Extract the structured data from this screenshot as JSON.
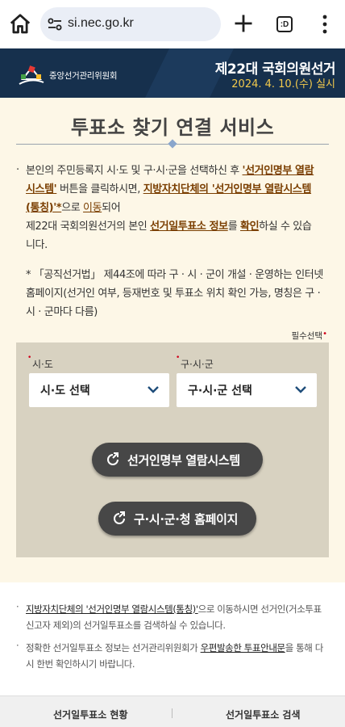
{
  "browser": {
    "url": "si.nec.go.kr",
    "tab_count": ":D"
  },
  "header": {
    "org_name": "중앙선거관리위원회",
    "election_title": "제22대 국회의원선거",
    "election_date": "2024. 4. 10.(수) 실시"
  },
  "main": {
    "title": "투표소 찾기 연결 서비스",
    "intro": {
      "p1": "본인의 주민등록지 시·도 및 구·시·군을 선택하신 후 ",
      "link1": "'선거인명부 열람시스템'",
      "p2": " 버튼을 클릭하시면, ",
      "link2": "지방자치단체의 '선거인명부 열람시스템(통칭)'*",
      "p3": "으로 ",
      "link3": "이동",
      "p4": "되어",
      "p5": "제22대 국회의원선거의 본인 ",
      "link4": "선거일투표소 정보",
      "p6": "를 ",
      "link5": "확인",
      "p7": "하실 수 있습니다."
    },
    "note": "* 「공직선거법」 제44조에 따라 구 · 시 · 군이 개설 · 운영하는 인터넷 홈페이지(선거인 여부, 등재번호 및 투표소 위치 확인 가능, 명칭은 구 · 시 · 군마다 다름)",
    "required_note": "필수선택"
  },
  "form": {
    "sido_label": "시·도",
    "sido_value": "시·도 선택",
    "gusigun_label": "구·시·군",
    "gusigun_value": "구·시·군 선택",
    "btn_registry": "선거인명부 열람시스템",
    "btn_homepage": "구·시·군·청 홈페이지"
  },
  "lower": {
    "item1_link": "지방자치단체의 '선거인명부 열람시스템(통칭)'",
    "item1_text": "으로 이동하시면 선거인(거소투표신고자 제외)의 선거일투표소를 검색하실 수 있습니다.",
    "item2_pre": "정확한 선거일투표소 정보는 선거관리위원회가 ",
    "item2_link": "우편발송한 투표안내문",
    "item2_post": "을 통해 다시 한번 확인하시기 바랍니다."
  },
  "footer": {
    "tab1": "선거일투표소 현황",
    "tab2": "선거일투표소 검색"
  },
  "colors": {
    "header_bg": "#16304d",
    "main_bg": "#fdf7e7",
    "form_bg": "#d8d2c1",
    "button_bg": "#474747",
    "accent_link": "#7a3e00",
    "date_yellow": "#f2c94c"
  }
}
